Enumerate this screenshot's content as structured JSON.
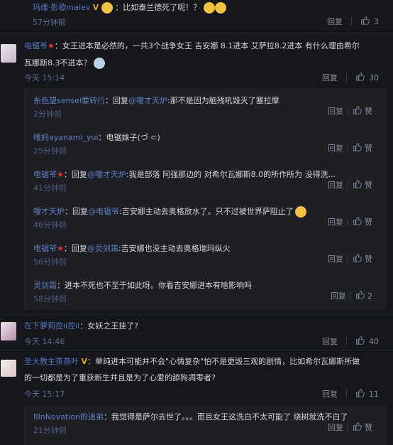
{
  "top": {
    "user": "玛维·影歌maiev",
    "text": "：比如泰兰德死了呢！？",
    "time": "57分钟前",
    "reply": "回复",
    "likes": "3"
  },
  "c1": {
    "user": "电锯爷",
    "text1": "：女王进本是必然的，一共3个战争女王 吉安娜 8.1进本 艾萨拉8.2进本 有什么理由希尔",
    "text2": "瓦娜斯8.3不进本？",
    "time": "今天 15:14",
    "reply": "回复",
    "likes": "30"
  },
  "subs": [
    {
      "user": "糸色望sensei要转行",
      "prefix": "：回复",
      "mention": "@噯才天炉",
      "text": ":那不是因为脑残吼毁灭了塞拉摩",
      "time": "2分钟前",
      "reply": "回复",
      "likes": "赞"
    },
    {
      "user": "唯妈ayanami_yui",
      "prefix": "：电锯妹子(つ゚ ⊂)",
      "mention": "",
      "text": "",
      "time": "25分钟前",
      "reply": "回复",
      "likes": "赞"
    },
    {
      "user": "电锯爷",
      "prefix": "：回复",
      "mention": "@噯才天炉",
      "text": ":我是部落 阿强那边的 对希尔瓦娜斯8.0的所作所为 没得洗...",
      "time": "41分钟前",
      "reply": "回复",
      "likes": "赞"
    },
    {
      "user": "噯才天炉",
      "prefix": "：回复",
      "mention": "@电锯爷",
      "text": ":吉安娜主动去奥格放水了。只不过被世界萨阻止了",
      "time": "46分钟前",
      "reply": "回复",
      "likes": "赞"
    },
    {
      "user": "电锯爷",
      "prefix": "：回复",
      "mention": "@灵剑霜",
      "text": ":吉安娜也没主动去奥格瑞玛纵火",
      "time": "56分钟前",
      "reply": "回复",
      "likes": "赞"
    },
    {
      "user": "灵剑霜",
      "prefix": "：进本不死也不至于如此呀。你看吉安娜进本有啥影响吗",
      "mention": "",
      "text": "",
      "time": "58分钟前",
      "reply": "回复",
      "likes": "2"
    }
  ],
  "c2": {
    "user": "在下萝莉控ii控ii",
    "text": "：女妖之王挂了?",
    "time": "今天 14:46",
    "reply": "回复",
    "likes": "40"
  },
  "c3": {
    "user": "圣大教主茶茶叶",
    "text1": "：单纯进本可能并不会\"心情复杂\"怕不是更毁三观的剧情，比如希尔瓦娜斯所做",
    "text2": "的一切都是为了重获新生并且是为了心爱的舔狗凋零者?",
    "time": "今天 15:17",
    "reply": "回复",
    "likes": "11"
  },
  "c3sub": {
    "user": "IIInNovation的迷弟",
    "text": "：我觉得是萨尔去世了。。。而且女王这洗白不太可能了 烧树就洗不白了",
    "time": "21分钟前",
    "reply": "回复",
    "likes": "赞"
  }
}
